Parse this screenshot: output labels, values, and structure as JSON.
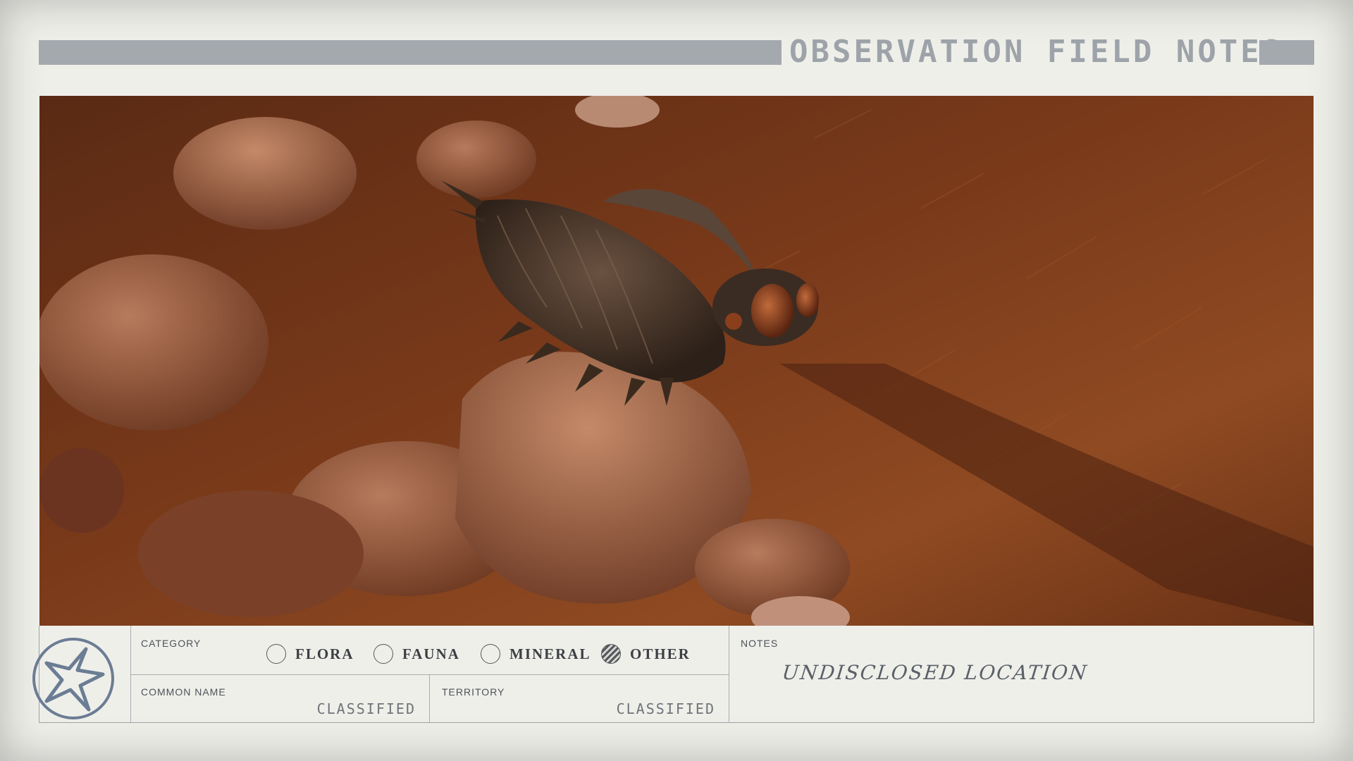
{
  "header": {
    "title": "OBSERVATION FIELD NOTES"
  },
  "photo": {
    "subject_icon": "creature-photo"
  },
  "form": {
    "category_label": "CATEGORY",
    "category_options": [
      {
        "label": "FLORA",
        "selected": false
      },
      {
        "label": "FAUNA",
        "selected": false
      },
      {
        "label": "MINERAL",
        "selected": false
      },
      {
        "label": "OTHER",
        "selected": true
      }
    ],
    "common_name_label": "COMMON NAME",
    "common_name_value": "CLASSIFIED",
    "territory_label": "TERRITORY",
    "territory_value": "CLASSIFIED",
    "notes_label": "NOTES",
    "notes_value": "UNDISCLOSED LOCATION"
  },
  "colors": {
    "paper": "#efefea",
    "header_bar": "#a4a9ae",
    "ink": "#3c3f43",
    "emblem": "#6b7d94"
  }
}
